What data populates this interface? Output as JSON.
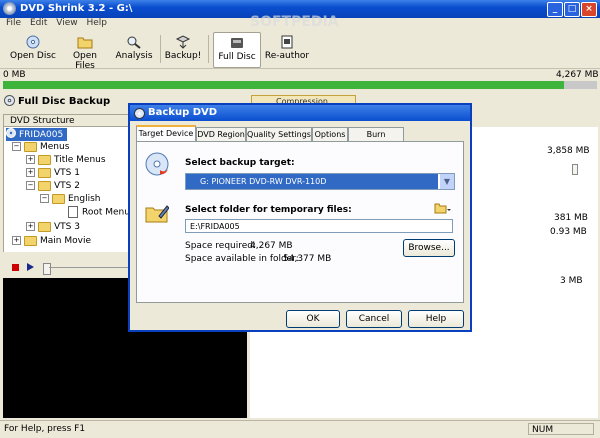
{
  "window": {
    "title": "DVD Shrink 3.2 - G:\\",
    "min": "_",
    "max": "□",
    "close": "×"
  },
  "watermark": "SOFTPEDIA",
  "menu": [
    "File",
    "Edit",
    "View",
    "Help"
  ],
  "toolbar": {
    "open_disc": "Open Disc",
    "open_files": "Open Files",
    "analysis": "Analysis",
    "backup": "Backup!",
    "full_disc": "Full Disc",
    "reauthor": "Re-author"
  },
  "sizes": {
    "left": "0 MB",
    "right": "4,267 MB"
  },
  "progress": {
    "fill_fraction": 0.945,
    "color": "#3fb43c"
  },
  "left_pane": {
    "title": "Full Disc Backup",
    "compression_button": "Compression Settings",
    "structure_header": "DVD Structure",
    "tree": [
      "FRIDA005",
      "Menus",
      "Title Menus",
      "VTS 1",
      "VTS 2",
      "English",
      "Root Menu",
      "VTS 3",
      "Main Movie"
    ]
  },
  "right_values": [
    "3,858 MB",
    "381 MB",
    "0.93 MB",
    "3 MB"
  ],
  "dialog": {
    "title": "Backup DVD",
    "tabs": [
      "Target Device",
      "DVD Region",
      "Quality Settings",
      "Options",
      "Burn Settings"
    ],
    "select_target_label": "Select backup target:",
    "target_value": "G: PIONEER DVD-RW DVR-110D",
    "select_folder_label": "Select folder for temporary files:",
    "folder_value": "E:\\FRIDA005",
    "browse": "Browse...",
    "space_required_label": "Space required:",
    "space_required_value": "4,267 MB",
    "space_available_label": "Space available in folder:",
    "space_available_value": "54,377 MB",
    "ok": "OK",
    "cancel": "Cancel",
    "help": "Help"
  },
  "status": {
    "text": "For Help, press F1",
    "num": "NUM"
  }
}
